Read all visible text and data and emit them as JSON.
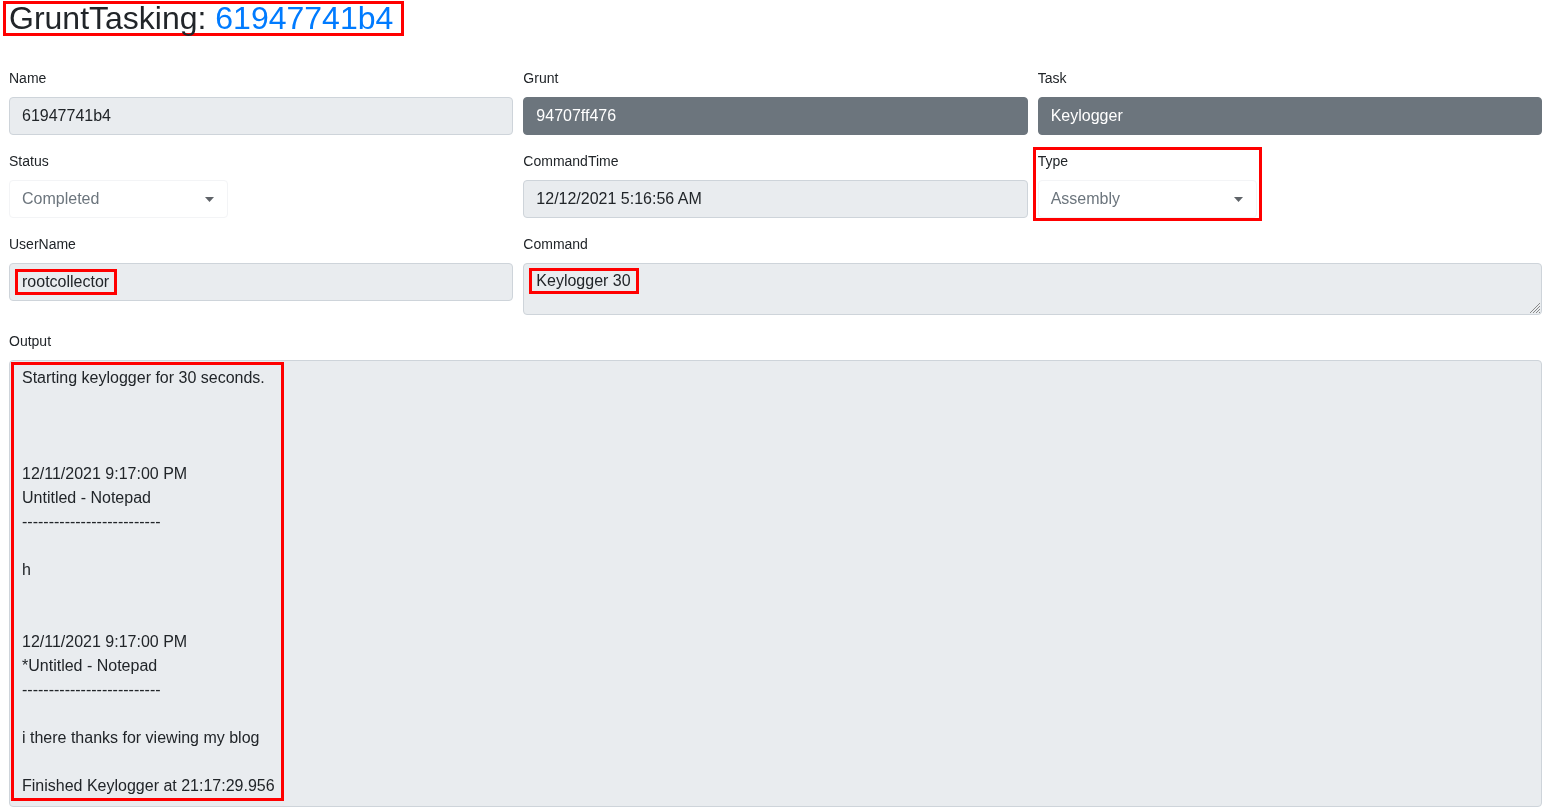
{
  "title": {
    "text": "GruntTasking:",
    "link": "61947741b4",
    "highlighted": true
  },
  "form_rows": [
    [
      {
        "label": "Name",
        "kind": "input",
        "value": "61947741b4"
      },
      {
        "label": "Grunt",
        "kind": "link",
        "value": "94707ff476"
      },
      {
        "label": "Task",
        "kind": "link",
        "value": "Keylogger"
      }
    ],
    [
      {
        "label": "Status",
        "kind": "select",
        "value": "Completed"
      },
      {
        "label": "CommandTime",
        "kind": "input",
        "value": "12/12/2021 5:16:56 AM"
      },
      {
        "label": "Type",
        "kind": "select",
        "value": "Assembly",
        "highlighted": true
      }
    ],
    [
      {
        "label": "UserName",
        "kind": "input",
        "value": "rootcollector",
        "value_highlighted": true
      },
      {
        "label": "Command",
        "kind": "textarea",
        "value": "Keylogger 30",
        "value_highlighted": true
      }
    ]
  ],
  "output": {
    "label": "Output",
    "text": "Starting keylogger for 30 seconds.\n\n\n\n12/11/2021 9:17:00 PM\nUntitled - Notepad\n--------------------------\n\nh\n\n\n12/11/2021 9:17:00 PM\n*Untitled - Notepad\n--------------------------\n\ni there thanks for viewing my blog\n\nFinished Keylogger at 21:17:29.956",
    "value_highlighted": true
  }
}
